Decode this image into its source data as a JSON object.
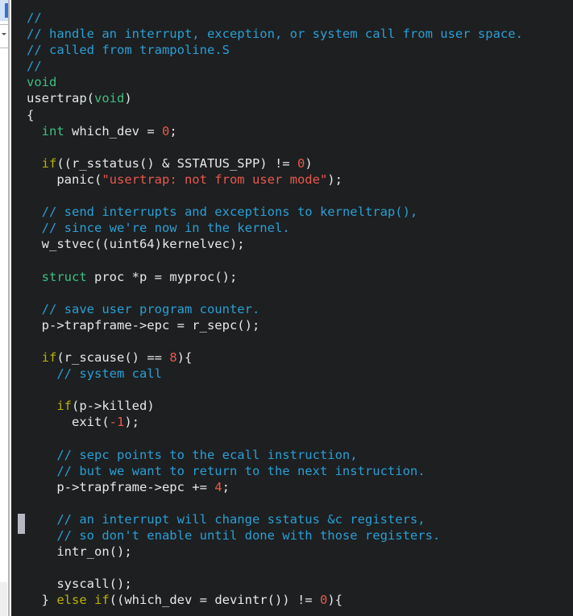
{
  "window": {
    "title": "trap.c",
    "theme_background": "#1d1f21",
    "colors": {
      "background": "#1d1f21",
      "foreground": "#e8e8e8",
      "comment": "#2b9fd4",
      "type_keyword": "#3fbf7f",
      "control_keyword": "#b9b300",
      "number": "#e8584c",
      "string": "#e8584c",
      "chrome_selection": "#cfe2f7",
      "chrome_marker": "#3a6fd0",
      "gutter_marker": "#b7b7c4"
    }
  },
  "chrome": {
    "selected_item_label": "",
    "popup_glyph": "chevron-down-icon",
    "bottom_strip_label": ""
  },
  "gutter": {
    "marker_label": "scroll-position-marker"
  },
  "code": {
    "language": "c",
    "lines": [
      [
        {
          "t": "cmt",
          "s": "//"
        }
      ],
      [
        {
          "t": "cmt",
          "s": "// handle an interrupt, exception, or system call from user space."
        }
      ],
      [
        {
          "t": "cmt",
          "s": "// called from trampoline.S"
        }
      ],
      [
        {
          "t": "cmt",
          "s": "//"
        }
      ],
      [
        {
          "t": "kw",
          "s": "void"
        }
      ],
      [
        {
          "t": "txt",
          "s": "usertrap("
        },
        {
          "t": "kw",
          "s": "void"
        },
        {
          "t": "txt",
          "s": ")"
        }
      ],
      [
        {
          "t": "txt",
          "s": "{"
        }
      ],
      [
        {
          "t": "txt",
          "s": "  "
        },
        {
          "t": "kw",
          "s": "int"
        },
        {
          "t": "txt",
          "s": " which_dev = "
        },
        {
          "t": "num",
          "s": "0"
        },
        {
          "t": "txt",
          "s": ";"
        }
      ],
      [
        {
          "t": "txt",
          "s": ""
        }
      ],
      [
        {
          "t": "txt",
          "s": "  "
        },
        {
          "t": "ctl",
          "s": "if"
        },
        {
          "t": "txt",
          "s": "((r_sstatus() & SSTATUS_SPP) != "
        },
        {
          "t": "num",
          "s": "0"
        },
        {
          "t": "txt",
          "s": ")"
        }
      ],
      [
        {
          "t": "txt",
          "s": "    panic("
        },
        {
          "t": "str",
          "s": "\"usertrap: not from user mode\""
        },
        {
          "t": "txt",
          "s": ");"
        }
      ],
      [
        {
          "t": "txt",
          "s": ""
        }
      ],
      [
        {
          "t": "txt",
          "s": "  "
        },
        {
          "t": "cmt",
          "s": "// send interrupts and exceptions to kerneltrap(),"
        }
      ],
      [
        {
          "t": "txt",
          "s": "  "
        },
        {
          "t": "cmt",
          "s": "// since we're now in the kernel."
        }
      ],
      [
        {
          "t": "txt",
          "s": "  w_stvec((uint64)kernelvec);"
        }
      ],
      [
        {
          "t": "txt",
          "s": ""
        }
      ],
      [
        {
          "t": "txt",
          "s": "  "
        },
        {
          "t": "kw",
          "s": "struct"
        },
        {
          "t": "txt",
          "s": " proc *p = myproc();"
        }
      ],
      [
        {
          "t": "txt",
          "s": ""
        }
      ],
      [
        {
          "t": "txt",
          "s": "  "
        },
        {
          "t": "cmt",
          "s": "// save user program counter."
        }
      ],
      [
        {
          "t": "txt",
          "s": "  p->trapframe->epc = r_sepc();"
        }
      ],
      [
        {
          "t": "txt",
          "s": ""
        }
      ],
      [
        {
          "t": "txt",
          "s": "  "
        },
        {
          "t": "ctl",
          "s": "if"
        },
        {
          "t": "txt",
          "s": "(r_scause() == "
        },
        {
          "t": "num",
          "s": "8"
        },
        {
          "t": "txt",
          "s": "){"
        }
      ],
      [
        {
          "t": "txt",
          "s": "    "
        },
        {
          "t": "cmt",
          "s": "// system call"
        }
      ],
      [
        {
          "t": "txt",
          "s": ""
        }
      ],
      [
        {
          "t": "txt",
          "s": "    "
        },
        {
          "t": "ctl",
          "s": "if"
        },
        {
          "t": "txt",
          "s": "(p->killed)"
        }
      ],
      [
        {
          "t": "txt",
          "s": "      exit("
        },
        {
          "t": "num",
          "s": "-1"
        },
        {
          "t": "txt",
          "s": ");"
        }
      ],
      [
        {
          "t": "txt",
          "s": ""
        }
      ],
      [
        {
          "t": "txt",
          "s": "    "
        },
        {
          "t": "cmt",
          "s": "// sepc points to the ecall instruction,"
        }
      ],
      [
        {
          "t": "txt",
          "s": "    "
        },
        {
          "t": "cmt",
          "s": "// but we want to return to the next instruction."
        }
      ],
      [
        {
          "t": "txt",
          "s": "    p->trapframe->epc += "
        },
        {
          "t": "num",
          "s": "4"
        },
        {
          "t": "txt",
          "s": ";"
        }
      ],
      [
        {
          "t": "txt",
          "s": ""
        }
      ],
      [
        {
          "t": "txt",
          "s": "    "
        },
        {
          "t": "cmt",
          "s": "// an interrupt will change sstatus &c registers,"
        }
      ],
      [
        {
          "t": "txt",
          "s": "    "
        },
        {
          "t": "cmt",
          "s": "// so don't enable until done with those registers."
        }
      ],
      [
        {
          "t": "txt",
          "s": "    intr_on();"
        }
      ],
      [
        {
          "t": "txt",
          "s": ""
        }
      ],
      [
        {
          "t": "txt",
          "s": "    syscall();"
        }
      ],
      [
        {
          "t": "txt",
          "s": "  } "
        },
        {
          "t": "ctl",
          "s": "else"
        },
        {
          "t": "txt",
          "s": " "
        },
        {
          "t": "ctl",
          "s": "if"
        },
        {
          "t": "txt",
          "s": "((which_dev = devintr()) != "
        },
        {
          "t": "num",
          "s": "0"
        },
        {
          "t": "txt",
          "s": "){"
        }
      ]
    ]
  }
}
